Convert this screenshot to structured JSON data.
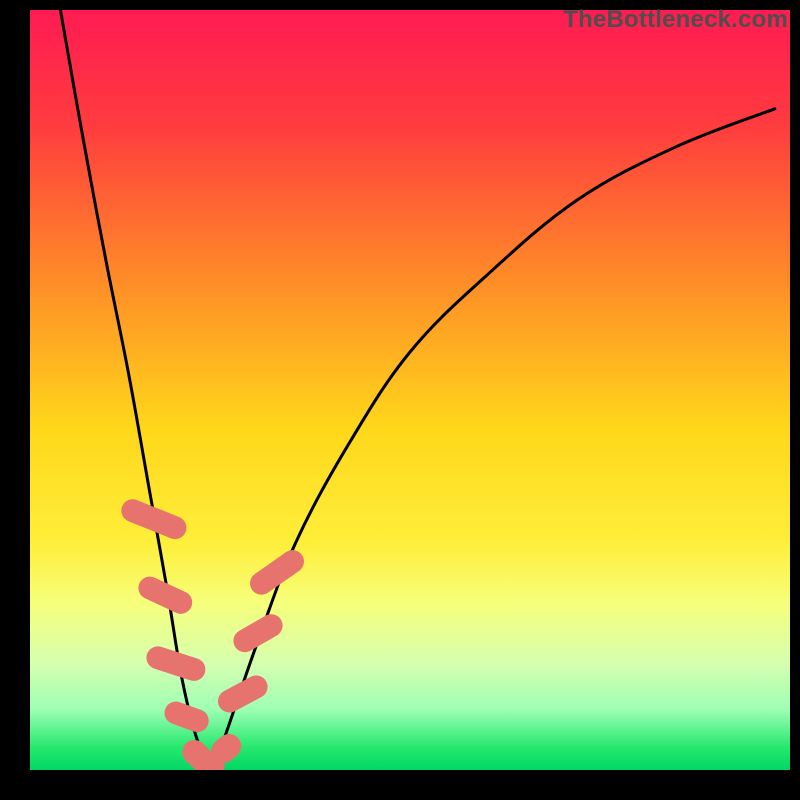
{
  "watermark": "TheBottleneck.com",
  "chart_data": {
    "type": "line",
    "title": "",
    "xlabel": "",
    "ylabel": "",
    "xlim": [
      0,
      100
    ],
    "ylim": [
      0,
      100
    ],
    "gradient_stops": [
      {
        "offset": 0,
        "color": "#ff1b52"
      },
      {
        "offset": 15,
        "color": "#ff3b3f"
      },
      {
        "offset": 35,
        "color": "#ff8a28"
      },
      {
        "offset": 55,
        "color": "#ffd71a"
      },
      {
        "offset": 70,
        "color": "#ffee3a"
      },
      {
        "offset": 78,
        "color": "#f6ff7a"
      },
      {
        "offset": 86,
        "color": "#d6ffb0"
      },
      {
        "offset": 92,
        "color": "#9dffb4"
      },
      {
        "offset": 97,
        "color": "#27e86f"
      },
      {
        "offset": 100,
        "color": "#00d864"
      }
    ],
    "series": [
      {
        "name": "bottleneck-curve",
        "x": [
          4,
          7,
          10,
          13,
          15.5,
          18,
          20,
          22,
          24,
          25.5,
          30,
          35,
          42,
          50,
          60,
          72,
          85,
          98
        ],
        "values": [
          100,
          83,
          67,
          52,
          38,
          24,
          12,
          4,
          0.5,
          4,
          17,
          30,
          43,
          55,
          65,
          75,
          82,
          87
        ]
      }
    ],
    "markers": {
      "name": "highlighted-segments",
      "color": "#e6736e",
      "points": [
        {
          "x": 16.3,
          "y": 33,
          "w": 3.0,
          "h": 9.0,
          "rot": -68
        },
        {
          "x": 17.8,
          "y": 23,
          "w": 3.0,
          "h": 7.5,
          "rot": -65
        },
        {
          "x": 19.2,
          "y": 14,
          "w": 3.0,
          "h": 8.0,
          "rot": -72
        },
        {
          "x": 20.6,
          "y": 7,
          "w": 3.0,
          "h": 6.0,
          "rot": -70
        },
        {
          "x": 22.0,
          "y": 2.0,
          "w": 3.2,
          "h": 4.2,
          "rot": -45
        },
        {
          "x": 23.6,
          "y": 0.5,
          "w": 4.0,
          "h": 3.0,
          "rot": 0
        },
        {
          "x": 25.8,
          "y": 2.8,
          "w": 3.2,
          "h": 4.2,
          "rot": 50
        },
        {
          "x": 28.0,
          "y": 10,
          "w": 3.0,
          "h": 7.0,
          "rot": 62
        },
        {
          "x": 30.0,
          "y": 18,
          "w": 3.0,
          "h": 7.0,
          "rot": 60
        },
        {
          "x": 32.5,
          "y": 26,
          "w": 3.0,
          "h": 8.0,
          "rot": 55
        }
      ]
    }
  }
}
